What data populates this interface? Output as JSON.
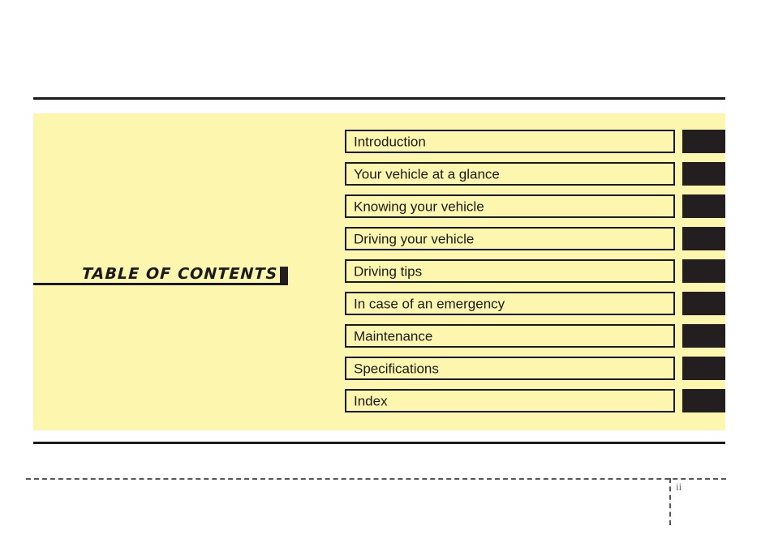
{
  "document": {
    "title": "TABLE OF CONTENTS",
    "page_number": "ii"
  },
  "theme": {
    "panel_background": "#fcf6af",
    "rule_color": "#1a1a1a",
    "tab_color": "#231f20",
    "text_color": "#1a1a1a",
    "folio_color": "#6d6e70",
    "crop_mark_color": "#58585a"
  },
  "contents": {
    "items": [
      {
        "label": "Introduction"
      },
      {
        "label": "Your vehicle at a glance"
      },
      {
        "label": "Knowing your vehicle"
      },
      {
        "label": "Driving your vehicle"
      },
      {
        "label": "Driving tips"
      },
      {
        "label": "In case of an emergency"
      },
      {
        "label": "Maintenance"
      },
      {
        "label": "Specifications"
      },
      {
        "label": "Index"
      }
    ]
  }
}
